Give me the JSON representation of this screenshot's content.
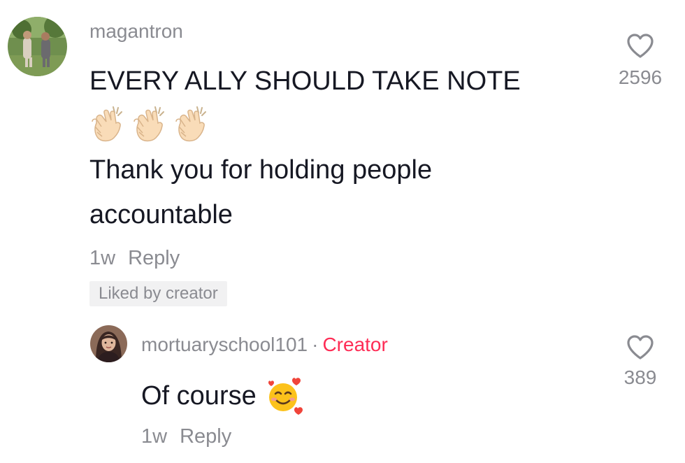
{
  "comment": {
    "username": "magantron",
    "line1": "EVERY ALLY SHOULD TAKE NOTE",
    "emoji": [
      "clapping-hands-emoji",
      "clapping-hands-emoji",
      "clapping-hands-emoji"
    ],
    "line2": "Thank you for holding people",
    "line3": "accountable",
    "time": "1w",
    "reply_label": "Reply",
    "liked_badge": "Liked by creator",
    "like_count": "2596",
    "heart_icon": "heart-outline-icon"
  },
  "reply": {
    "username": "mortuaryschool101",
    "separator": "·",
    "creator_label": "Creator",
    "text": "Of course",
    "emoji": "smiling-face-with-hearts-emoji",
    "time": "1w",
    "reply_label": "Reply",
    "like_count": "389",
    "heart_icon": "heart-outline-icon"
  },
  "colors": {
    "creator_accent": "#fe2c55",
    "secondary_text": "#8a8b91",
    "primary_text": "#161823",
    "badge_bg": "#f1f1f2"
  }
}
